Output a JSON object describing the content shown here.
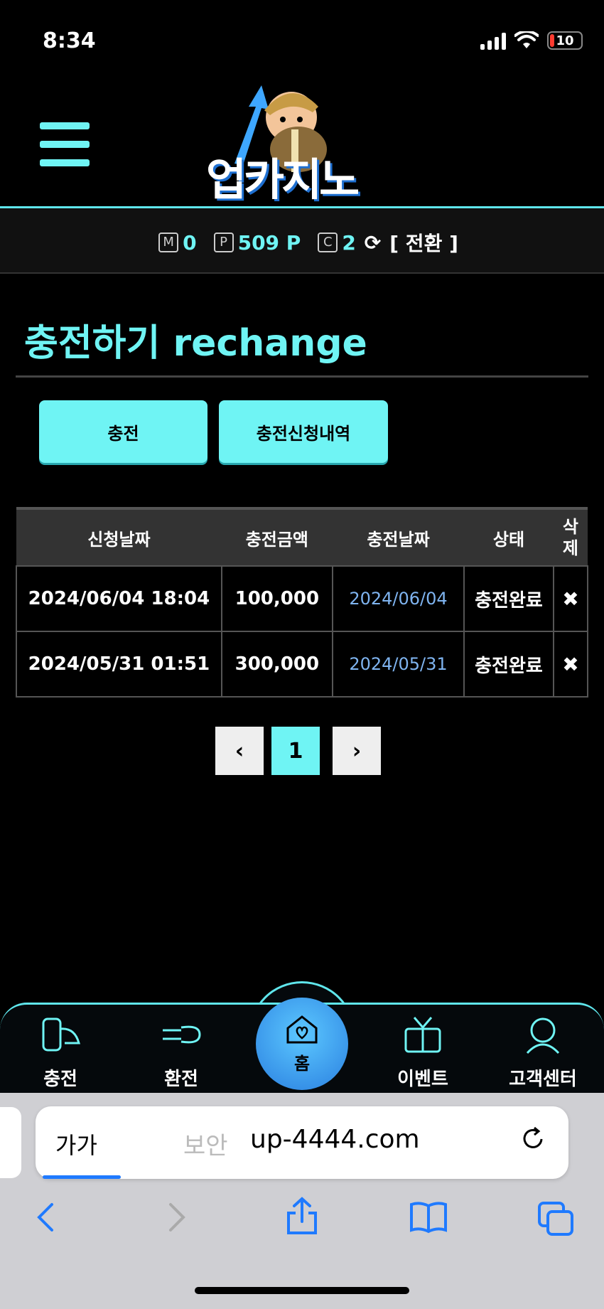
{
  "status_bar": {
    "time": "8:34",
    "battery": "10"
  },
  "header": {
    "logo_text": "업카지노"
  },
  "points": {
    "m_badge": "M",
    "m_value": "0",
    "p_badge": "P",
    "p_value": "509 P",
    "c_badge": "C",
    "c_value": "2",
    "switch_label": "[ 전환 ]"
  },
  "page": {
    "title": "충전하기 rechange"
  },
  "buttons": {
    "recharge": "충전",
    "history": "충전신청내역"
  },
  "table": {
    "headers": [
      "신청날짜",
      "충전금액",
      "충전날짜",
      "상태",
      "삭제"
    ],
    "rows": [
      {
        "request_date": "2024/06/04 18:04",
        "amount": "100,000",
        "charge_date": "2024/06/04",
        "status": "충전완료",
        "delete": "✖"
      },
      {
        "request_date": "2024/05/31 01:51",
        "amount": "300,000",
        "charge_date": "2024/05/31",
        "status": "충전완료",
        "delete": "✖"
      }
    ]
  },
  "pagination": {
    "prev": "‹",
    "current": "1",
    "next": "›"
  },
  "bottom_nav": {
    "recharge": "충전",
    "exchange": "환전",
    "home": "홈",
    "event": "이벤트",
    "support": "고객센터"
  },
  "browser": {
    "aa": "가가",
    "secure": "보안 ",
    "domain": "up-4444.com"
  },
  "colors": {
    "accent": "#6ff4f4",
    "blue_date": "#7fb4f0",
    "safari_blue": "#1f7aff"
  }
}
